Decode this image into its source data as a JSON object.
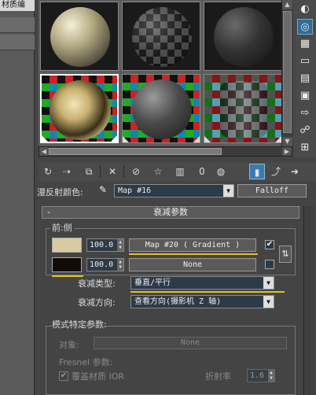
{
  "left_panel": {
    "title": "材质编"
  },
  "material": {
    "label": "漫反射颜色:",
    "map_name": "Map #16",
    "type_button": "Falloff"
  },
  "rollout": {
    "title": "衰减参数",
    "minus": "-",
    "front_side_label": "前:侧",
    "row1": {
      "value": "100.0",
      "map": "Map #20  ( Gradient )",
      "checked": "✔",
      "color": "#d8cba0"
    },
    "row2": {
      "value": "100.0",
      "map": "None",
      "color": "#120c08"
    },
    "swap_icon": "swap-icon",
    "falloff_type_label": "衰减类型:",
    "falloff_type_value": "垂直/平行",
    "falloff_dir_label": "衰减方向:",
    "falloff_dir_value": "查看方向(摄影机 Z 轴)"
  },
  "mode_params": {
    "title": "模式特定参数:",
    "object_label": "对象:",
    "object_value": "None",
    "fresnel_label": "Fresnel 参数:",
    "override_ior_label": "覆盖材质 IOR",
    "ior_label": "折射率",
    "ior_value": "1.6"
  },
  "toolbar": {
    "icons": [
      "get-material-icon",
      "put-to-scene-icon",
      "assign-to-selection-icon",
      "reset-icon",
      "make-copy-icon",
      "make-unique-icon",
      "put-to-library-icon",
      "material-id-icon",
      "show-in-viewport-icon",
      "show-end-result-icon",
      "go-to-parent-icon",
      "go-forward-icon"
    ],
    "mat_id": "0"
  },
  "colors": {
    "accent": "#3a7ab0",
    "highlight_underline": "#e0c030"
  }
}
